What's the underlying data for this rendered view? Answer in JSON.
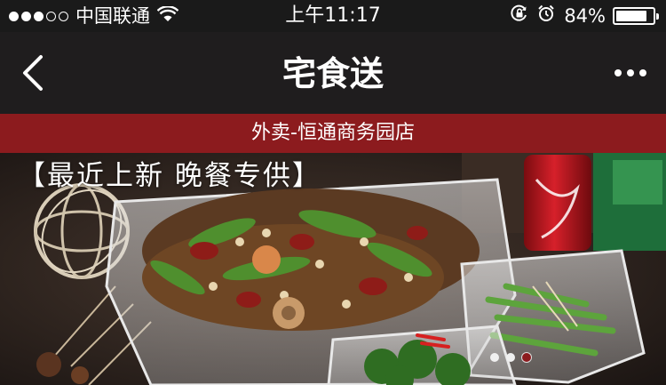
{
  "status_bar": {
    "carrier": "中国联通",
    "time": "上午11:17",
    "battery": "84%",
    "signal_icon": "signal-dots-icon",
    "wifi_icon": "wifi-icon",
    "rotation_lock_icon": "rotation-lock-icon",
    "alarm_icon": "alarm-icon"
  },
  "nav": {
    "title": "宅食送",
    "back_icon": "chevron-left-icon",
    "more_icon": "more-dots-icon"
  },
  "store": {
    "name": "外卖-恒通商务园店"
  },
  "banner": {
    "caption": "【最近上新 晚餐专供】",
    "slide_count": 3,
    "active_slide": 3
  },
  "colors": {
    "nav_bg": "#1f1d1e",
    "store_bar_bg": "#8c1b1e",
    "status_bg": "#1a1a1a"
  }
}
